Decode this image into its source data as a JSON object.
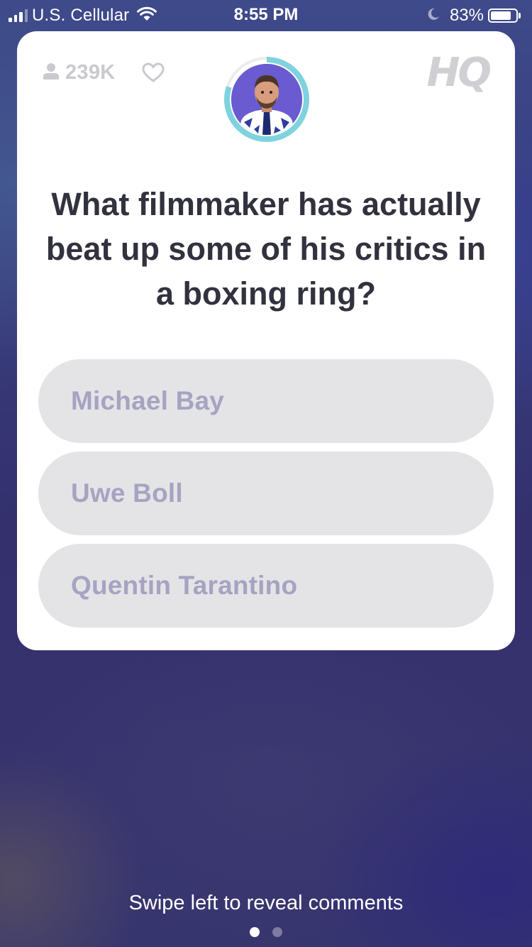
{
  "status_bar": {
    "carrier": "U.S. Cellular",
    "time": "8:55 PM",
    "battery_percent": "83%",
    "battery_level": 0.83,
    "signal_bars": 3
  },
  "header": {
    "viewer_count": "239K",
    "logo": "HQ",
    "timer_progress": 0.8
  },
  "question": {
    "text": "What filmmaker has actually beat up some of his critics in a boxing ring?"
  },
  "answers": [
    {
      "label": "Michael Bay"
    },
    {
      "label": "Uwe Boll"
    },
    {
      "label": "Quentin Tarantino"
    }
  ],
  "footer": {
    "hint": "Swipe left to reveal comments",
    "pages": 2,
    "active_page": 1
  },
  "colors": {
    "card": "#ffffff",
    "question_text": "#32323f",
    "answer_bg": "#e4e4e6",
    "answer_text": "#a6a3c2",
    "timer_ring": "#7ed3df",
    "muted": "#c9c9ce"
  }
}
